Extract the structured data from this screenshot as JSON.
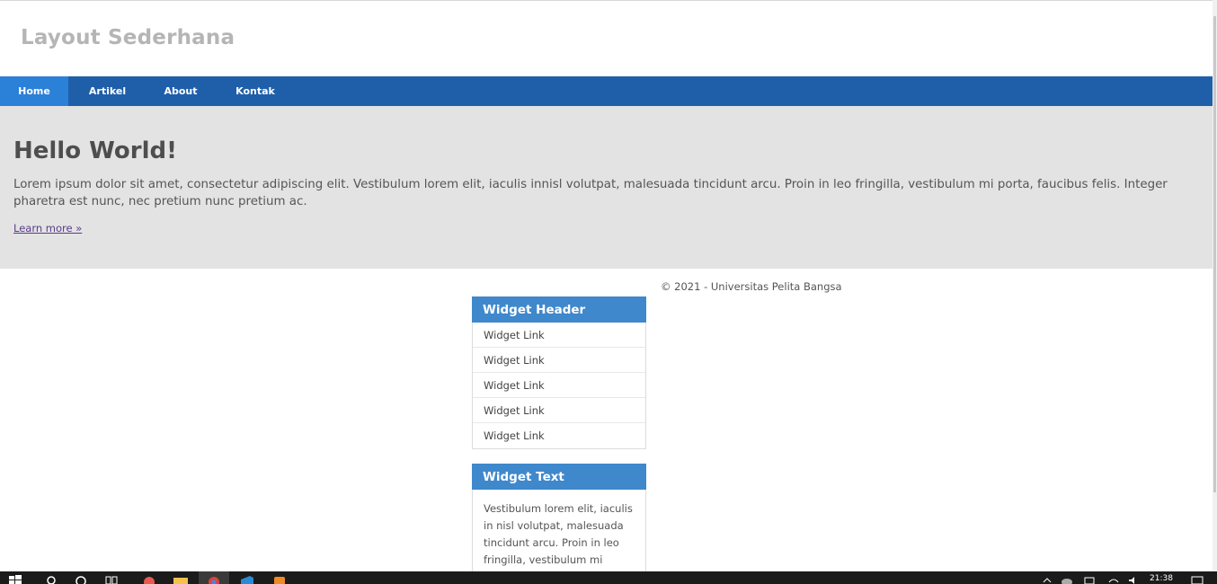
{
  "site": {
    "title": "Layout Sederhana"
  },
  "nav": {
    "items": [
      {
        "label": "Home",
        "active": true
      },
      {
        "label": "Artikel",
        "active": false
      },
      {
        "label": "About",
        "active": false
      },
      {
        "label": "Kontak",
        "active": false
      }
    ]
  },
  "hero": {
    "title": "Hello World!",
    "text": "Lorem ipsum dolor sit amet, consectetur adipiscing elit. Vestibulum lorem elit, iaculis innisl volutpat, malesuada tincidunt arcu. Proin in leo fringilla, vestibulum mi porta, faucibus felis. Integer pharetra est nunc, nec pretium nunc pretium ac.",
    "link": "Learn more »"
  },
  "footer": {
    "copyright": "© 2021 - Universitas Pelita Bangsa"
  },
  "widgets": {
    "links": {
      "header": "Widget Header",
      "items": [
        "Widget Link",
        "Widget Link",
        "Widget Link",
        "Widget Link",
        "Widget Link"
      ]
    },
    "text": {
      "header": "Widget Text",
      "body": "Vestibulum lorem elit, iaculis in nisl volutpat, malesuada tincidunt arcu. Proin in leo fringilla, vestibulum mi porta, faucibus felis."
    }
  },
  "taskbar": {
    "clock": "21:38"
  },
  "colors": {
    "nav": "#1f5faa",
    "nav_active": "#2b80d8",
    "hero_bg": "#e3e3e3",
    "widget_header": "#3f88cc",
    "taskbar": "#1b1b1b"
  }
}
